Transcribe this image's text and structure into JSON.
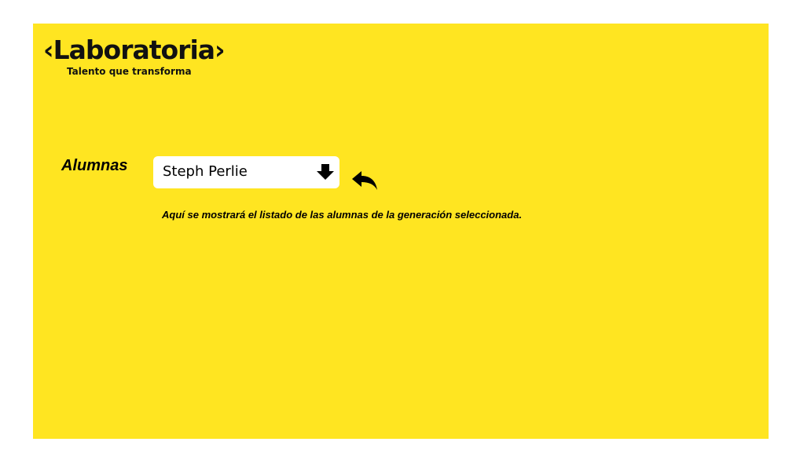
{
  "brand": {
    "name": "‹Laboratoria›",
    "tagline": "Talento que transforma"
  },
  "filter": {
    "label": "Alumnas",
    "selected": "Steph Perlie"
  },
  "content": {
    "message": "Aquí se mostrará el listado de las alumnas de la generación seleccionada."
  },
  "colors": {
    "background": "#ffe521",
    "text": "#000000",
    "select_bg": "#ffffff"
  },
  "icons": {
    "dropdown": "arrow-down-icon",
    "back": "undo-arrow-icon"
  }
}
